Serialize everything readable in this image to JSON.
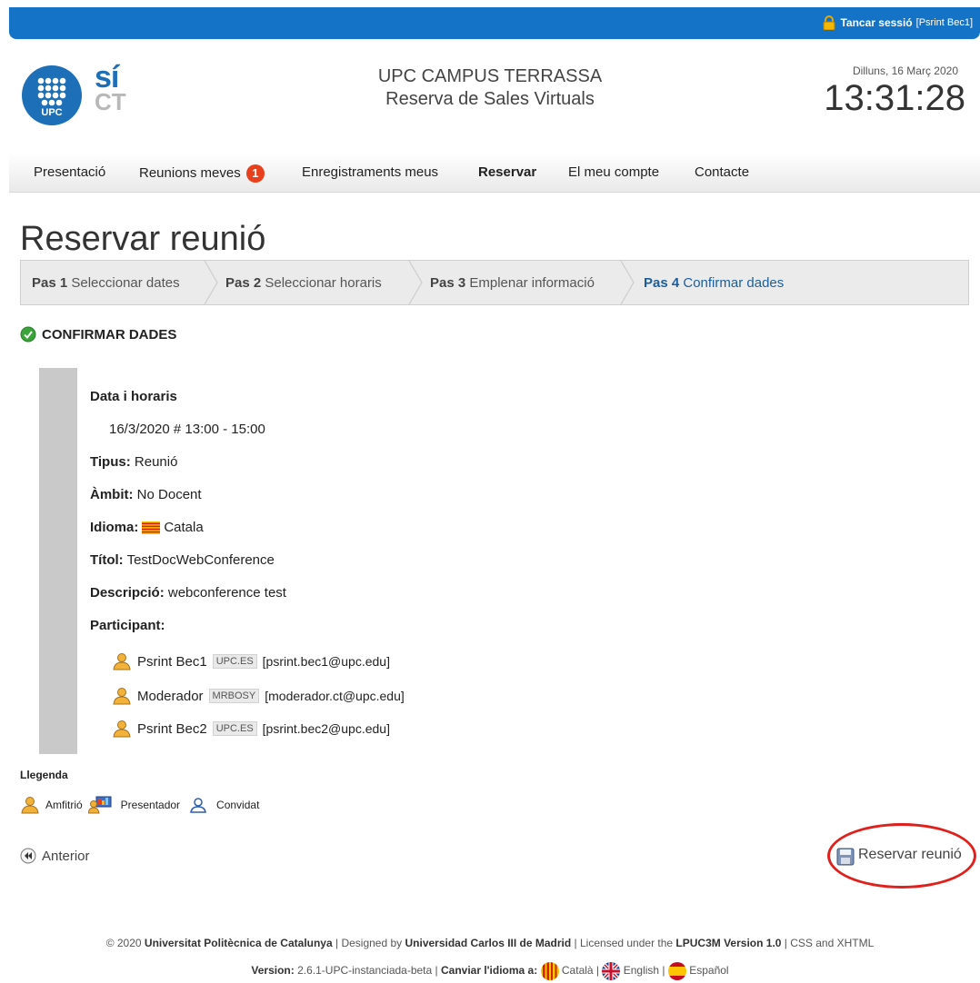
{
  "header": {
    "logout_label": "Tancar sessió",
    "user_label": "[Psrint Bec1]",
    "site_line1": "UPC CAMPUS TERRASSA",
    "site_line2": "Reserva de Sales Virtuals",
    "date": "Dilluns, 16 Març 2020",
    "time": "13:31:28",
    "logo_upc_text": "UPC",
    "logo_sict_line1": "sí",
    "logo_sict_line2": "CT"
  },
  "nav": {
    "items": [
      {
        "label": "Presentació"
      },
      {
        "label": "Reunions meves",
        "badge": "1"
      },
      {
        "label": "Enregistraments meus"
      },
      {
        "label": "Reservar",
        "active": true
      },
      {
        "label": "El meu compte"
      },
      {
        "label": "Contacte"
      }
    ]
  },
  "page": {
    "title": "Reservar reunió",
    "steps": [
      {
        "num": "Pas 1",
        "label": "Seleccionar dates"
      },
      {
        "num": "Pas 2",
        "label": "Seleccionar horaris"
      },
      {
        "num": "Pas 3",
        "label": "Emplenar informació"
      },
      {
        "num": "Pas 4",
        "label": "Confirmar dades",
        "current": true
      }
    ],
    "section_title": "CONFIRMAR DADES"
  },
  "details": {
    "dates_label": "Data i horaris",
    "dates_value": "16/3/2020 # 13:00 - 15:00",
    "type_label": "Tipus:",
    "type_value": "Reunió",
    "scope_label": "Àmbit:",
    "scope_value": "No Docent",
    "lang_label": "Idioma:",
    "lang_value": "Catala",
    "title_label": "Títol:",
    "title_value": "TestDocWebConference",
    "desc_label": "Descripció:",
    "desc_value": "webconference test",
    "participants_label": "Participant:",
    "participants": [
      {
        "name": "Psrint Bec1",
        "tag": "UPC.ES",
        "email": "[psrint.bec1@upc.edu]"
      },
      {
        "name": "Moderador",
        "tag": "MRBOSY",
        "email": "[moderador.ct@upc.edu]"
      },
      {
        "name": "Psrint Bec2",
        "tag": "UPC.ES",
        "email": "[psrint.bec2@upc.edu]"
      }
    ]
  },
  "legend": {
    "title": "Llegenda",
    "host": "Amfitrió",
    "presenter": "Presentador",
    "guest": "Convidat"
  },
  "actions": {
    "prev": "Anterior",
    "submit": "Reservar reunió"
  },
  "footer": {
    "copyright": "© 2020",
    "university": "Universitat Politècnica de Catalunya",
    "sep1": " | Designed by ",
    "designer": "Universidad Carlos III de Madrid",
    "sep2": " | Licensed under the ",
    "license": "LPUC3M Version 1.0",
    "sep3": " | CSS and XHTML",
    "version_label": "Version:",
    "version_value": "2.6.1-UPC-instanciada-beta",
    "change_lang_label": "Canviar l'idioma a:",
    "lang_ca": "Català",
    "lang_en": "English",
    "lang_es": "Español"
  },
  "colors": {
    "topbar": "#1473c7",
    "step_current": "#1a5e9e",
    "badge": "#e8401c",
    "annotation": "#e0201c"
  }
}
